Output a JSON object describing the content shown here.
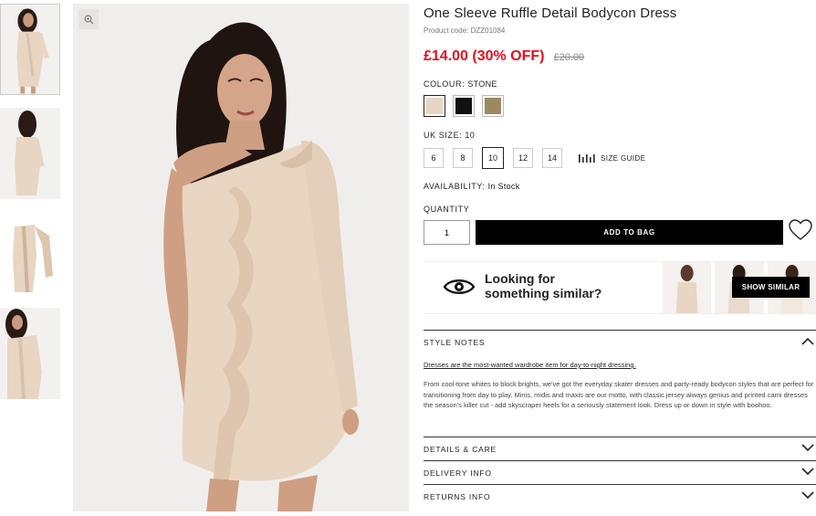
{
  "product": {
    "title": "One Sleeve Ruffle Detail Bodycon Dress",
    "code": "Product code: DZZ01084",
    "price_now": "£14.00 (30% OFF)",
    "price_was": "£20.00"
  },
  "colour": {
    "label": "COLOUR:",
    "value": "STONE",
    "swatches": [
      "#e8d5c2",
      "#111111",
      "#9c8a5f"
    ]
  },
  "size": {
    "label": "UK SIZE:",
    "value": "10",
    "options": [
      "6",
      "8",
      "10",
      "12",
      "14"
    ],
    "guide_label": "SIZE GUIDE"
  },
  "availability": {
    "label": "AVAILABILITY:",
    "value": "In Stock"
  },
  "quantity": {
    "label": "QUANTITY",
    "value": "1"
  },
  "add_to_bag": "ADD TO BAG",
  "similar": {
    "line1": "Looking for",
    "line2": "something similar?",
    "button": "SHOW SIMILAR"
  },
  "style_notes": {
    "title": "STYLE NOTES",
    "subtitle": "Dresses are the most-wanted wardrobe item for day-to-night dressing.",
    "body": "From cool-tone whites to block brights, we've got the everyday skater dresses and party-ready bodycon styles that are perfect for transitioning from day to play. Minis, midis and maxis are our motto, with classic jersey always genius and printed cami dresses the season's killer cut - add skyscraper heels for a seriously statement look. Dress up or down in style with boohoo."
  },
  "accordions": {
    "details": "DETAILS & CARE",
    "delivery": "DELIVERY INFO",
    "returns": "RETURNS INFO"
  },
  "colors": {
    "sale_red": "#e4101f",
    "dress": "#e8d5c2",
    "button_bg": "#000000"
  }
}
